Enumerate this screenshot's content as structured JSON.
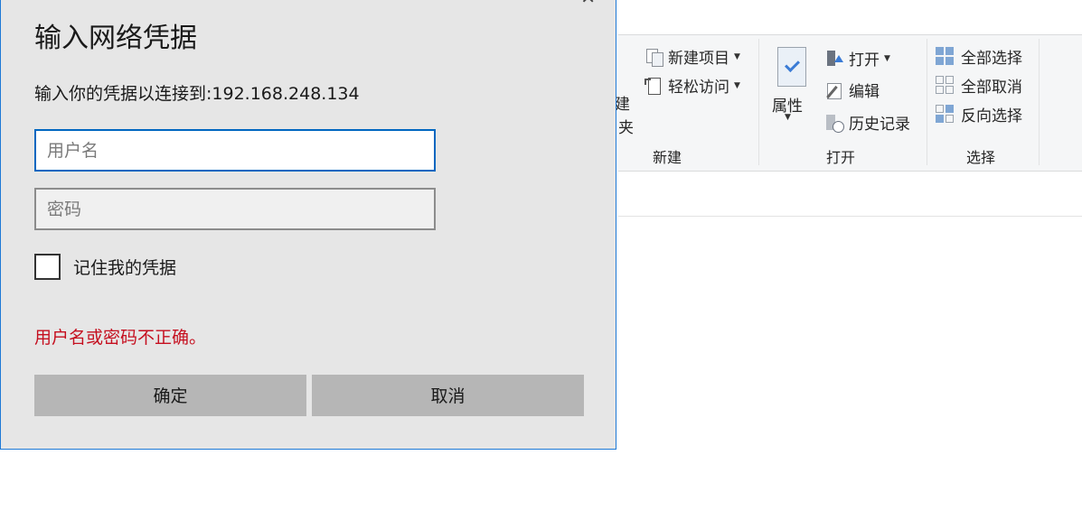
{
  "explorer": {
    "partial_text": [
      "建",
      "夹"
    ],
    "new_group": {
      "label": "新建",
      "new_item": "新建项目",
      "easy_access": "轻松访问"
    },
    "open_group": {
      "label": "打开",
      "properties": "属性",
      "open": "打开",
      "edit": "编辑",
      "history": "历史记录"
    },
    "select_group": {
      "label": "选择",
      "select_all": "全部选择",
      "select_none": "全部取消",
      "invert": "反向选择"
    },
    "accent_color": "#3a7bd5"
  },
  "dialog": {
    "title": "输入网络凭据",
    "message": "输入你的凭据以连接到:192.168.248.134",
    "username_placeholder": "用户名",
    "username_value": "",
    "password_placeholder": "密码",
    "remember_label": "记住我的凭据",
    "remember_checked": false,
    "error": "用户名或密码不正确。",
    "ok_label": "确定",
    "cancel_label": "取消",
    "error_color": "#c50f1f",
    "focus_color": "#0067c0"
  }
}
